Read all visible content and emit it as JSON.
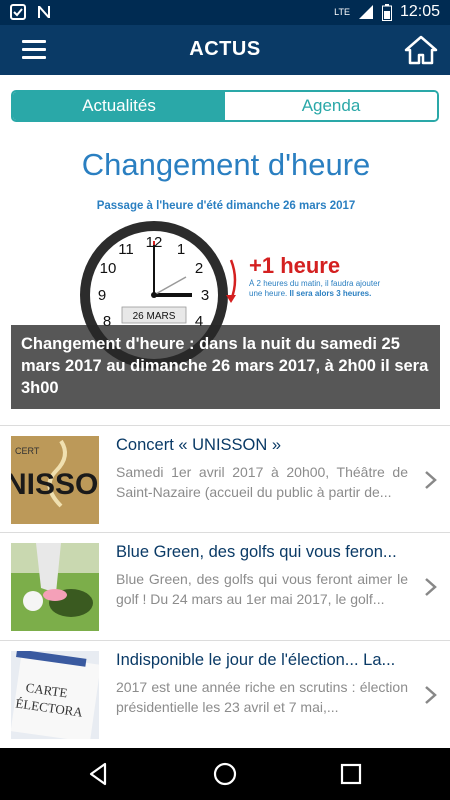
{
  "status_bar": {
    "time": "12:05",
    "network": "LTE"
  },
  "app_bar": {
    "title": "ACTUS"
  },
  "tabs": [
    {
      "label": "Actualités",
      "active": true
    },
    {
      "label": "Agenda",
      "active": false
    }
  ],
  "hero": {
    "image_title": "Changement d'heure",
    "image_subtitle": "Passage à l'heure d'été dimanche 26 mars 2017",
    "clock_date": "26 MARS",
    "plus_hour": "+1 heure",
    "image_note": "À 2 heures du matin, il faudra ajouter une heure.",
    "image_note_bold": "Il sera alors 3 heures.",
    "caption": "Changement d'heure : dans la nuit du samedi 25 mars 2017 au dimanche 26 mars 2017, à 2h00 il sera 3h00"
  },
  "articles": [
    {
      "title": "Concert « UNISSON »",
      "description": "Samedi 1er avril 2017 à 20h00, Théâtre de Saint-Nazaire (accueil du public à partir de..."
    },
    {
      "title": "Blue Green, des golfs qui vous feron...",
      "description": "Blue Green, des golfs qui vous feront aimer le golf ! Du 24 mars au 1er mai 2017, le golf..."
    },
    {
      "title": "Indisponible le jour de l'élection... La...",
      "description": "2017 est une année riche en scrutins : élection présidentielle les 23 avril et 7 mai,..."
    }
  ],
  "colors": {
    "app_bar": "#0a3a66",
    "status_bar": "#002b52",
    "accent": "#2aa8a8",
    "title_text": "#0a3a66"
  },
  "icons": [
    "menu-icon",
    "home-icon",
    "chevron-right-icon",
    "back-icon",
    "home-nav-icon",
    "recents-icon"
  ]
}
